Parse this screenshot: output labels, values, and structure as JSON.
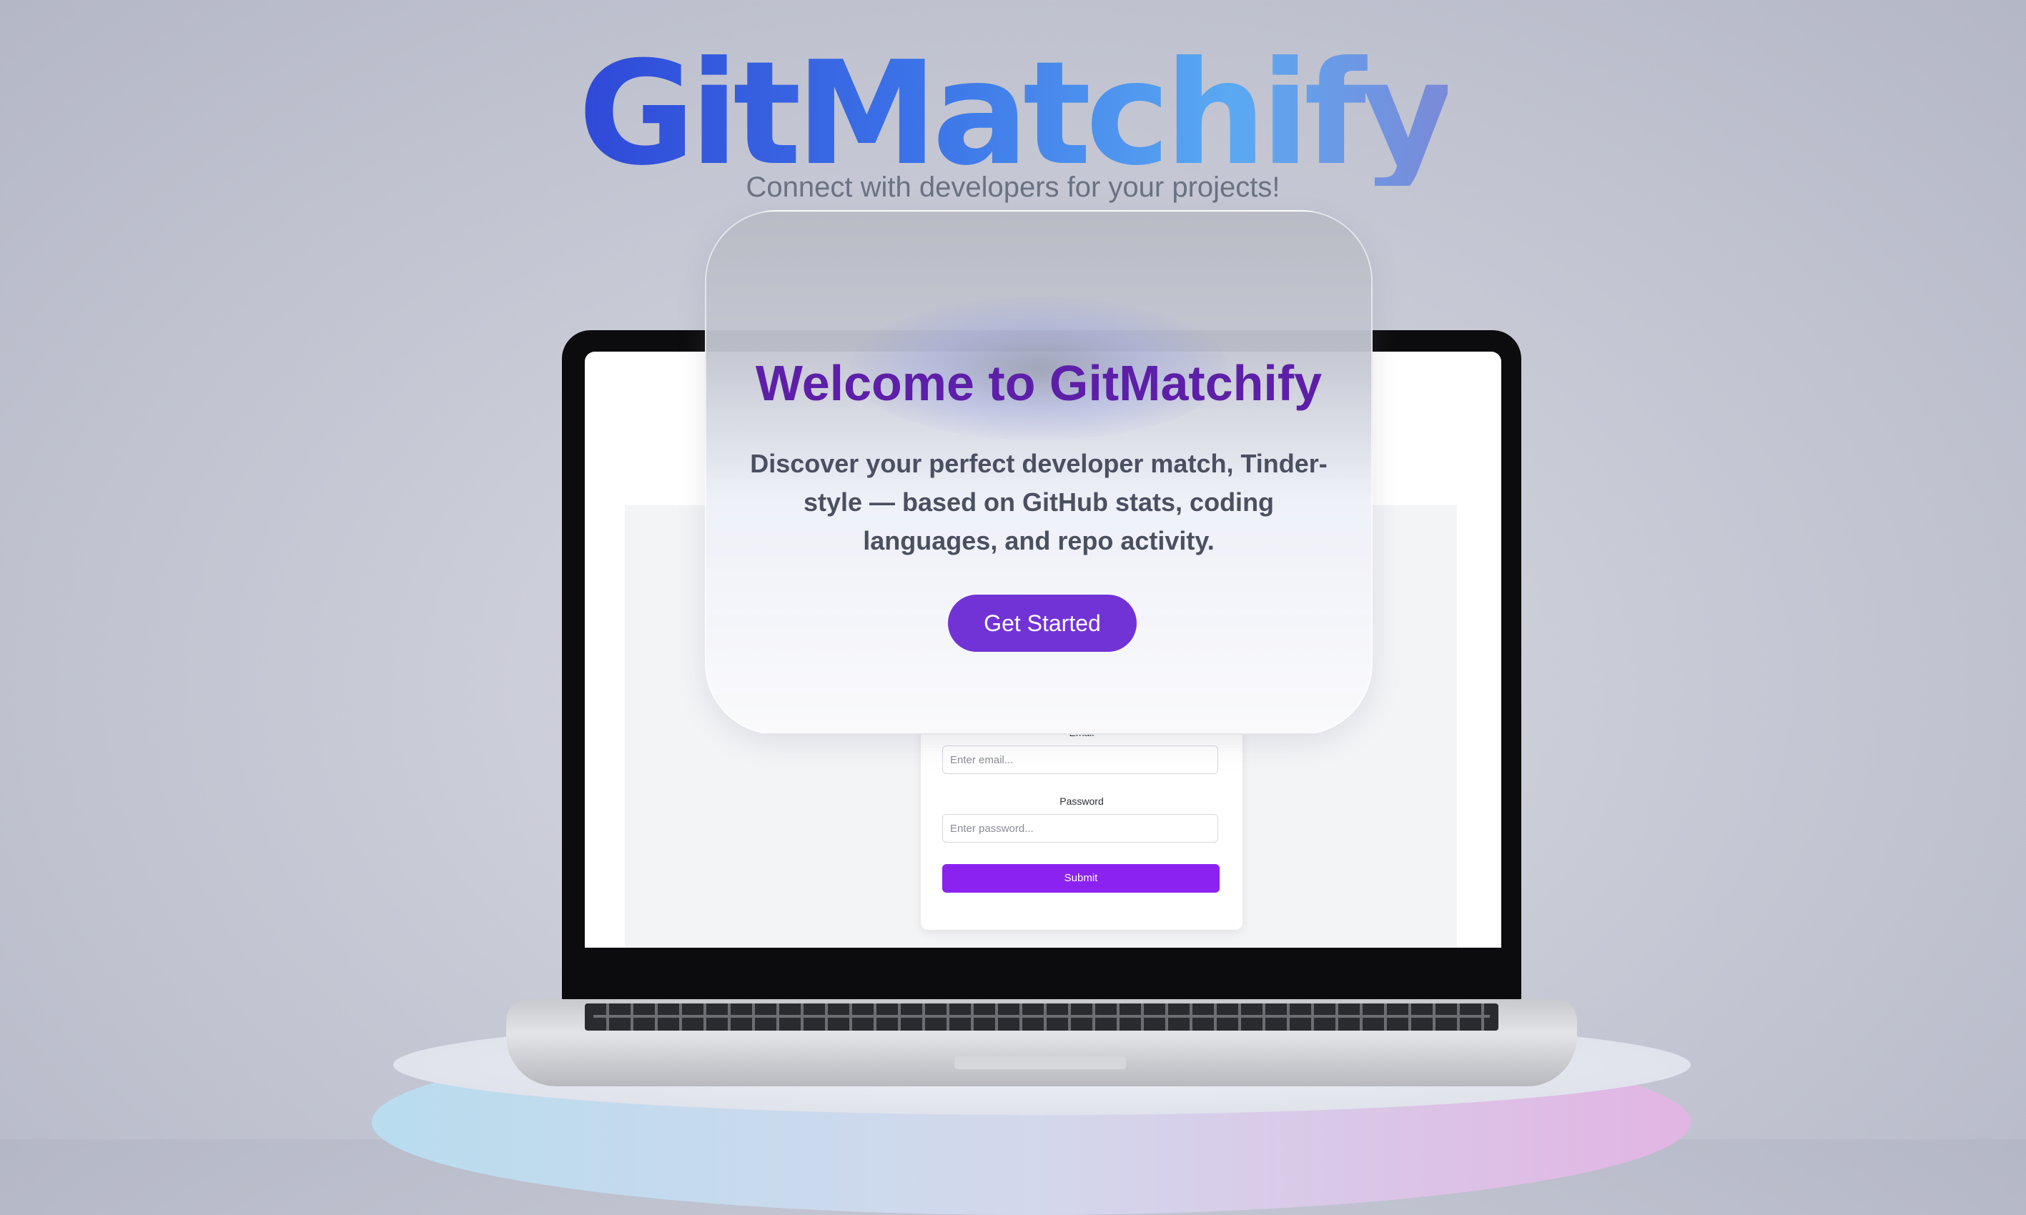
{
  "brand": {
    "title": "GitMatchify",
    "tagline": "Connect with developers for your projects!"
  },
  "welcome": {
    "heading": "Welcome to GitMatchify",
    "description": "Discover your perfect developer match, Tinder-style — based on GitHub stats, coding languages, and repo activity.",
    "cta_label": "Get Started"
  },
  "login_form": {
    "email_label": "Email",
    "email_placeholder": "Enter email...",
    "password_label": "Password",
    "password_placeholder": "Enter password...",
    "submit_label": "Submit"
  },
  "colors": {
    "accent": "#7233d6",
    "heading": "#5d1fa8",
    "submit": "#8b22f0"
  }
}
